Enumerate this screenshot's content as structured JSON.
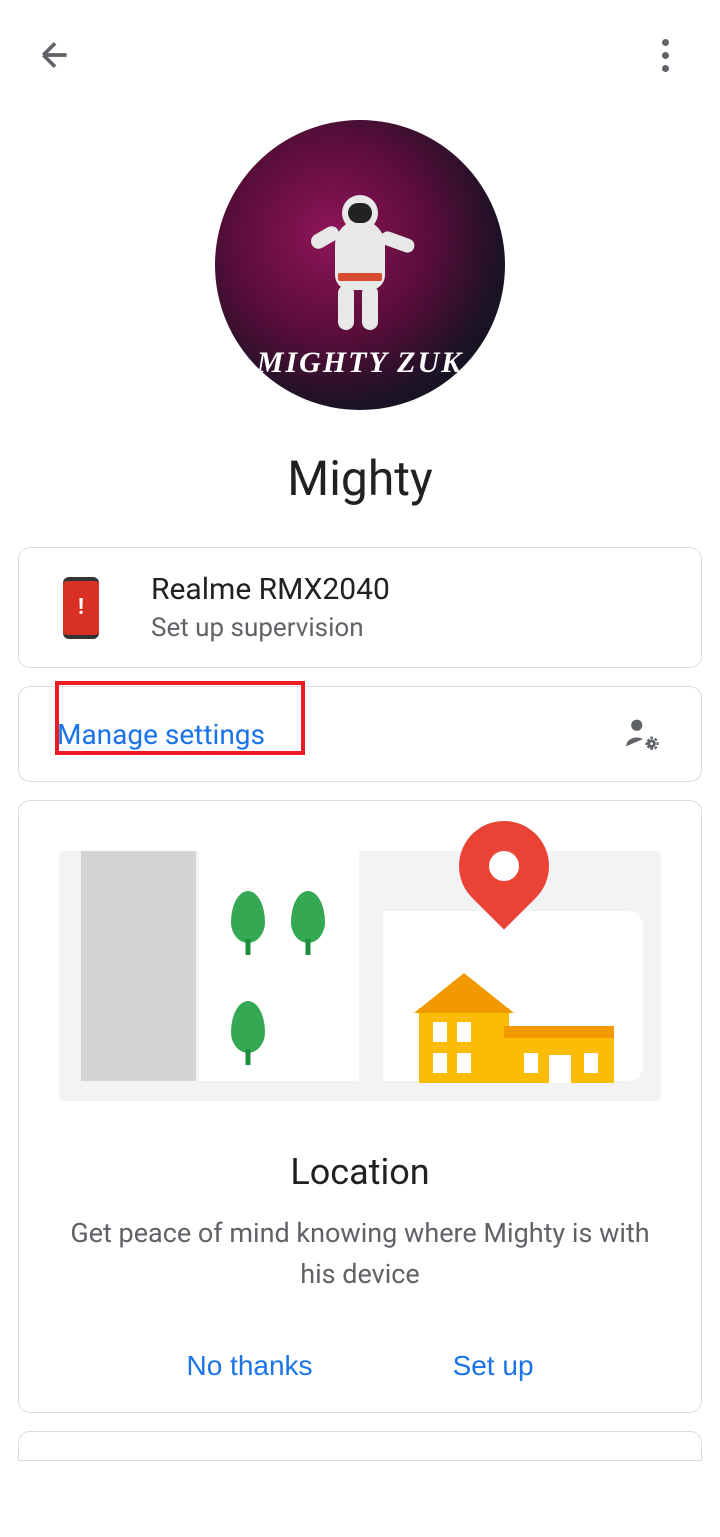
{
  "header": {
    "back": "Back",
    "more": "More options"
  },
  "profile": {
    "avatar_text": "MIGHTY ZUK",
    "name": "Mighty"
  },
  "device": {
    "name": "Realme RMX2040",
    "subtitle": "Set up supervision",
    "alert": "!"
  },
  "manage": {
    "label": "Manage settings"
  },
  "location": {
    "title": "Location",
    "description": "Get peace of mind knowing where Mighty is with his device",
    "decline": "No thanks",
    "accept": "Set up"
  }
}
